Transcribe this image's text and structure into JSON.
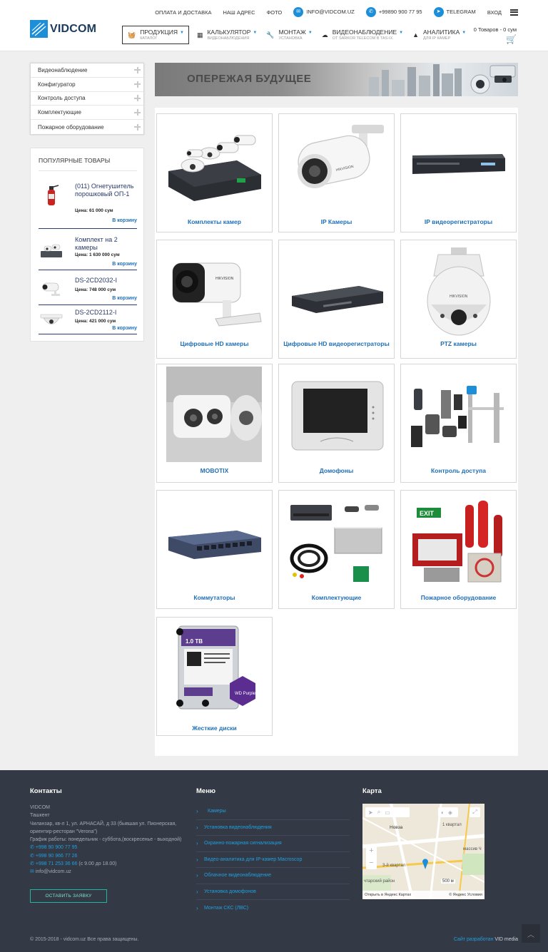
{
  "header": {
    "logo_text": "VIDCOM",
    "topbar": {
      "payment": "ОПЛАТА И ДОСТАВКА",
      "address": "НАШ АДРЕС",
      "photo": "ФОТО",
      "email": "INFO@VIDCOM.UZ",
      "phone": "+99890 900 77 95",
      "telegram": "TELEGRAM",
      "login": "ВХОД"
    },
    "nav": [
      {
        "label": "ПРОДУКЦИЯ",
        "sub": "КАТАЛОГ",
        "icon": "basket-icon"
      },
      {
        "label": "КАЛЬКУЛЯТОР",
        "sub": "ВИДЕОНАБЛЮДЕНИЯ",
        "icon": "calculator-icon"
      },
      {
        "label": "МОНТАЖ",
        "sub": "УСТАНОВКА",
        "icon": "wrench-icon"
      },
      {
        "label": "ВИДЕОНАБЛЮДЕНИЕ",
        "sub": "ОТ SARKOR TELECOM В TAS-IX",
        "icon": "cloud-icon"
      },
      {
        "label": "АНАЛИТИКА",
        "sub": "ДЛЯ IP КАМЕР",
        "icon": "chart-icon"
      }
    ],
    "cart": "0  Товаров - 0 сум"
  },
  "sidebar": {
    "categories": [
      "Видеонаблюдение",
      "Конфигуратор",
      "Контроль доступа",
      "Комплектующие",
      "Пожарное оборудование"
    ],
    "popular_title": "ПОПУЛЯРНЫЕ ТОВАРЫ",
    "popular": [
      {
        "name": "(011) Огнетушитель порошковый ОП-1",
        "price": "Цена: 61 000 сум",
        "buy": "В корзину"
      },
      {
        "name": "Комплект на 2 камеры",
        "price": "Цена: 1 630 000 сум",
        "buy": "В корзину"
      },
      {
        "name": "DS-2CD2032-I",
        "price": "Цена: 748 000 сум",
        "buy": "В корзину"
      },
      {
        "name": "DS-2CD2112-I",
        "price": "Цена: 421 000 сум",
        "buy": "В корзину"
      }
    ]
  },
  "banner": {
    "text": "ОПЕРЕЖАЯ БУДУЩЕЕ"
  },
  "products": [
    "Комплекты камер",
    "IP Камеры",
    "IP видеорегистраторы",
    "Цифровые HD камеры",
    "Цифровые HD видеорегистраторы",
    "PTZ камеры",
    "MOBOTIX",
    "Домофоны",
    "Контроль доступа",
    "Коммутаторы",
    "Комплектующие",
    "Пожарное оборудование",
    "Жесткие диски"
  ],
  "footer": {
    "contacts_title": "Контакты",
    "contacts": {
      "company": "VIDCOM",
      "city": "Ташкент",
      "address": "Чиланзар, кв-л 1, ул. АРНАСАЙ, д 33 (бывшая ул. Пионерская, ориентир-ресторан \"Verona\")",
      "hours": "График работы: понедельник - суббота,(воскресенье - выходной)",
      "phone1": "+998 90 900 77 95",
      "phone2": "+998 90 966 77 26",
      "phone3": "+998 71 253 36 66",
      "phone3_note": "(с 9.00 до 18.00)",
      "email": "info@vidcom.uz"
    },
    "apply_button": "ОСТАВИТЬ ЗАЯВКУ",
    "menu_title": "Меню",
    "menu": [
      "Камеры",
      "Установка видеонаблюдения",
      "Охранно-пожарная сигнализация",
      "Видео-аналитика для IP-камер Macroscop",
      "Облачное видеонаблюдение",
      "Установка домофонов",
      "Монтаж СКС (ЛВС)"
    ],
    "map_title": "Карта",
    "map": {
      "label_kvartal": "1 квартал",
      "label_nova": "Новза",
      "label_3kv": "3-й квартал",
      "label_district": "чтарский район",
      "label_massiv": "массив Ч",
      "label_scale": "500 м",
      "label_open": "Открыть в Яндекс Картах",
      "label_yandex": "© Яндекс Условия"
    },
    "copyright": "© 2015-2018 - vidcom.uz Все права защищены.",
    "dev_label": "Сайт разработан",
    "dev_name": "VID media"
  }
}
